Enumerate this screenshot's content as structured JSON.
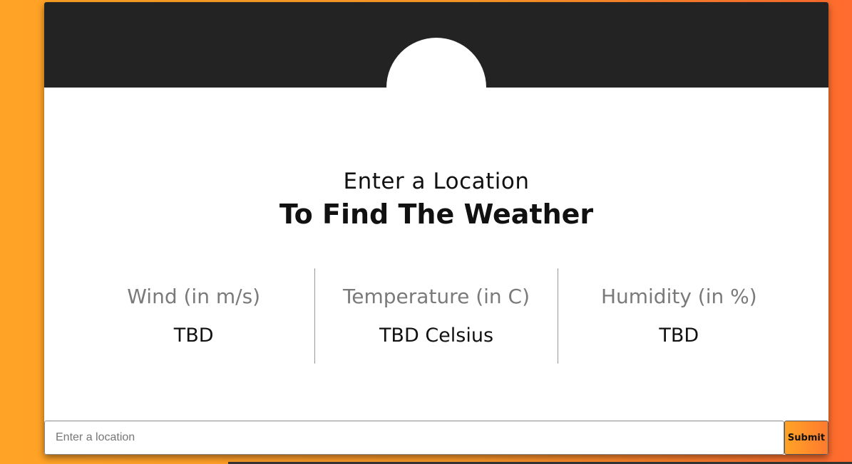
{
  "heading": {
    "line1": "Enter a Location",
    "line2": "To Find The Weather"
  },
  "stats": [
    {
      "label": "Wind (in m/s)",
      "value": "TBD"
    },
    {
      "label": "Temperature (in C)",
      "value": "TBD Celsius"
    },
    {
      "label": "Humidity (in %)",
      "value": "TBD"
    }
  ],
  "search": {
    "placeholder": "Enter a location",
    "value": "",
    "submit_label": "Submit"
  },
  "colors": {
    "background_gradient_start": "#FFA326",
    "background_gradient_end": "#FF6B2E",
    "header": "#232323",
    "card": "#FFFFFF"
  }
}
